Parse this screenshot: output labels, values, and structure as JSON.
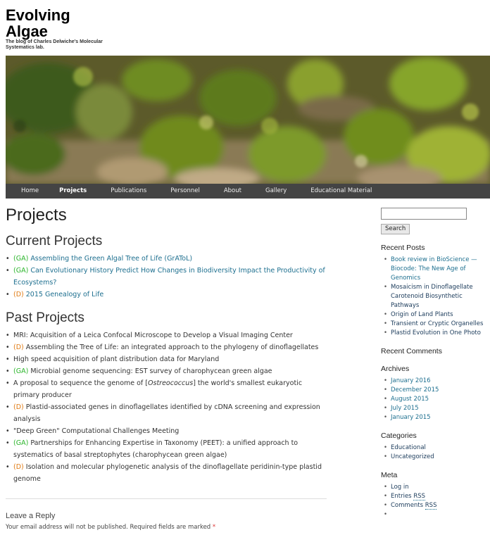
{
  "site": {
    "title": "Evolving Algae",
    "description": "The blog of Charles Delwiche's Molecular Systematics lab."
  },
  "nav": [
    "Home",
    "Projects",
    "Publications",
    "Personnel",
    "About",
    "Gallery",
    "Educational Material"
  ],
  "nav_active": "Projects",
  "page": {
    "title": "Projects",
    "current_heading": "Current Projects",
    "current": [
      {
        "tag": "(GA)",
        "text": "Assembling the Green Algal Tree of Life (GrAToL)"
      },
      {
        "tag": "(GA)",
        "text": "Can Evolutionary History Predict How Changes in Biodiversity Impact the Productivity of Ecosystems?"
      },
      {
        "tag": "(D)",
        "text": "2015 Genealogy of Life"
      }
    ],
    "past_heading": "Past Projects",
    "past": [
      {
        "tag": "",
        "text": "MRI: Acquisition of a Leica Confocal Microscope to Develop a Visual Imaging Center"
      },
      {
        "tag": "(D)",
        "text": "Assembling the Tree of Life: an integrated approach to the phylogeny of dinoflagellates"
      },
      {
        "tag": "",
        "text": "High speed acquisition of plant distribution data for Maryland"
      },
      {
        "tag": "(GA)",
        "text": "Microbial genome sequencing: EST survey of charophycean green algae"
      },
      {
        "tag": "",
        "pre": "A proposal to sequence the genome of [",
        "italic": "Ostreococcus",
        "post": "] the world's smallest eukaryotic primary producer"
      },
      {
        "tag": "(D)",
        "text": "Plastid-associated genes in dinoflagellates identified by cDNA screening and expression analysis"
      },
      {
        "tag": "",
        "text": "\"Deep Green\" Computational Challenges Meeting"
      },
      {
        "tag": "(GA)",
        "text": "Partnerships for Enhancing Expertise in Taxonomy (PEET): a unified approach to systematics of basal streptophytes (charophycean green algae)"
      },
      {
        "tag": "(D)",
        "text": "Isolation and molecular phylogenetic analysis of the dinoflagellate peridinin-type plastid genome"
      }
    ]
  },
  "reply": {
    "title": "Leave a Reply",
    "note": "Your email address will not be published. Required fields are marked",
    "required_mark": "*"
  },
  "sidebar": {
    "search_value": "",
    "search_button": "Search",
    "recent_posts_title": "Recent Posts",
    "recent_posts": [
      "Book review in BioScience — Biocode: The New Age of Genomics",
      "Mosaicism in Dinoflagellate Carotenoid Biosynthetic Pathways",
      "Origin of Land Plants",
      "Transient or Cryptic Organelles",
      "Plastid Evolution in One Photo"
    ],
    "recent_comments_title": "Recent Comments",
    "archives_title": "Archives",
    "archives": [
      "January 2016",
      "December 2015",
      "August 2015",
      "July 2015",
      "January 2015"
    ],
    "categories_title": "Categories",
    "categories": [
      "Educational",
      "Uncategorized"
    ],
    "meta_title": "Meta",
    "meta": {
      "login": "Log in",
      "entries_pre": "Entries ",
      "entries_abbr": "RSS",
      "comments_pre": "Comments ",
      "comments_abbr": "RSS"
    }
  },
  "colors": {
    "nav_bg": "#444444",
    "link": "#1d6f8f",
    "tag_ga": "#2bb52b",
    "tag_d": "#e07a12"
  }
}
